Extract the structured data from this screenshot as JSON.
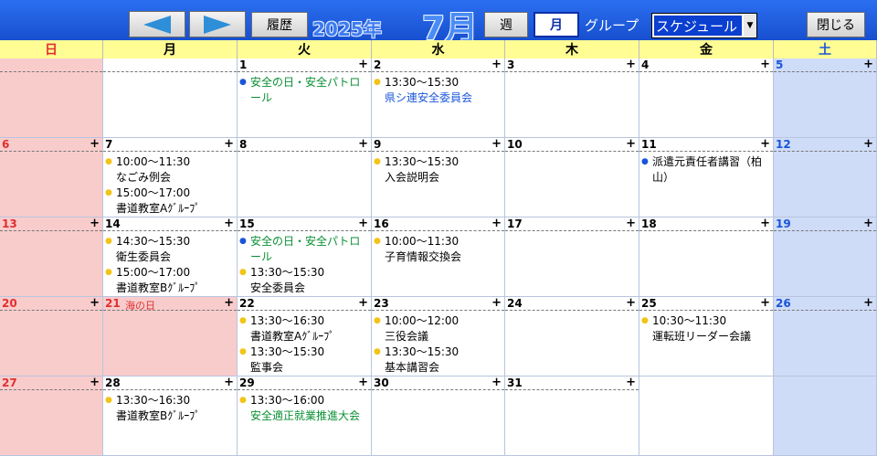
{
  "toolbar": {
    "prev_icon": "left-arrow-icon",
    "next_icon": "right-arrow-icon",
    "history": "履歴",
    "year": "2025年",
    "month": "7月",
    "week": "週",
    "month_btn": "月",
    "group": "グループ",
    "view_select": "スケジュール",
    "close": "閉じる"
  },
  "colors": {
    "sunday_bg": "#f9cccc",
    "saturday_bg": "#cfdcf7",
    "holiday_bg": "#f9cccc",
    "header_bg": "#fffd94",
    "sunday_text": "#e03030",
    "saturday_text": "#1a55d8",
    "green_dot": "#0a8f33",
    "blue_dot": "#1a55d8",
    "yellow_dot": "#f2c417"
  },
  "weekdays": [
    "日",
    "月",
    "火",
    "水",
    "木",
    "金",
    "土"
  ],
  "weeks": [
    [
      {
        "num": "",
        "type": "sun",
        "events": []
      },
      {
        "num": "",
        "type": "normal",
        "events": []
      },
      {
        "num": "1",
        "type": "normal",
        "events": [
          {
            "time": "",
            "title": "安全の日・安全パトロール",
            "dot": "blue",
            "color": "green"
          }
        ]
      },
      {
        "num": "2",
        "type": "normal",
        "events": [
          {
            "time": "13:30～15:30",
            "title": "県シ連安全委員会",
            "dot": "yellow",
            "color": "blue"
          }
        ]
      },
      {
        "num": "3",
        "type": "normal",
        "events": []
      },
      {
        "num": "4",
        "type": "normal",
        "events": []
      },
      {
        "num": "5",
        "type": "sat",
        "events": []
      }
    ],
    [
      {
        "num": "6",
        "type": "sun",
        "events": []
      },
      {
        "num": "7",
        "type": "normal",
        "events": [
          {
            "time": "10:00～11:30",
            "title": "なごみ例会",
            "dot": "yellow",
            "color": "black"
          },
          {
            "time": "15:00～17:00",
            "title": "書道教室Aｸﾞﾙｰﾌﾟ",
            "dot": "yellow",
            "color": "black"
          }
        ]
      },
      {
        "num": "8",
        "type": "normal",
        "events": []
      },
      {
        "num": "9",
        "type": "normal",
        "events": [
          {
            "time": "13:30～15:30",
            "title": "入会説明会",
            "dot": "yellow",
            "color": "black"
          }
        ]
      },
      {
        "num": "10",
        "type": "normal",
        "events": []
      },
      {
        "num": "11",
        "type": "normal",
        "events": [
          {
            "time": "",
            "title": "派遣元責任者講習（柏山）",
            "dot": "blue",
            "color": "black"
          }
        ]
      },
      {
        "num": "12",
        "type": "sat",
        "events": []
      }
    ],
    [
      {
        "num": "13",
        "type": "sun",
        "events": []
      },
      {
        "num": "14",
        "type": "normal",
        "events": [
          {
            "time": "14:30～15:30",
            "title": "衛生委員会",
            "dot": "yellow",
            "color": "black"
          },
          {
            "time": "15:00～17:00",
            "title": "書道教室Bｸﾞﾙｰﾌﾟ",
            "dot": "yellow",
            "color": "black"
          }
        ]
      },
      {
        "num": "15",
        "type": "normal",
        "events": [
          {
            "time": "",
            "title": "安全の日・安全パトロール",
            "dot": "blue",
            "color": "green"
          },
          {
            "time": "13:30～15:30",
            "title": "安全委員会",
            "dot": "yellow",
            "color": "black"
          }
        ]
      },
      {
        "num": "16",
        "type": "normal",
        "events": [
          {
            "time": "10:00～11:30",
            "title": "子育情報交換会",
            "dot": "yellow",
            "color": "black"
          }
        ]
      },
      {
        "num": "17",
        "type": "normal",
        "events": []
      },
      {
        "num": "18",
        "type": "normal",
        "events": []
      },
      {
        "num": "19",
        "type": "sat",
        "events": []
      }
    ],
    [
      {
        "num": "20",
        "type": "sun",
        "events": []
      },
      {
        "num": "21",
        "type": "holiday",
        "holiday": "海の日",
        "events": []
      },
      {
        "num": "22",
        "type": "normal",
        "events": [
          {
            "time": "13:30～16:30",
            "title": "書道教室Aｸﾞﾙｰﾌﾟ",
            "dot": "yellow",
            "color": "black"
          },
          {
            "time": "13:30～15:30",
            "title": "監事会",
            "dot": "yellow",
            "color": "black"
          }
        ]
      },
      {
        "num": "23",
        "type": "normal",
        "events": [
          {
            "time": "10:00～12:00",
            "title": "三役会議",
            "dot": "yellow",
            "color": "black"
          },
          {
            "time": "13:30～15:30",
            "title": "基本講習会",
            "dot": "yellow",
            "color": "black"
          }
        ]
      },
      {
        "num": "24",
        "type": "normal",
        "events": []
      },
      {
        "num": "25",
        "type": "normal",
        "events": [
          {
            "time": "10:30～11:30",
            "title": "運転班リーダー会議",
            "dot": "yellow",
            "color": "black"
          }
        ]
      },
      {
        "num": "26",
        "type": "sat",
        "events": []
      }
    ],
    [
      {
        "num": "27",
        "type": "sun",
        "events": []
      },
      {
        "num": "28",
        "type": "normal",
        "events": [
          {
            "time": "13:30～16:30",
            "title": "書道教室Bｸﾞﾙｰﾌﾟ",
            "dot": "yellow",
            "color": "black"
          }
        ]
      },
      {
        "num": "29",
        "type": "normal",
        "events": [
          {
            "time": "13:30～16:00",
            "title": "安全適正就業推進大会",
            "dot": "yellow",
            "color": "green"
          }
        ]
      },
      {
        "num": "30",
        "type": "normal",
        "events": []
      },
      {
        "num": "31",
        "type": "normal",
        "events": []
      },
      {
        "num": "",
        "type": "normal",
        "events": []
      },
      {
        "num": "",
        "type": "sat",
        "events": []
      }
    ]
  ],
  "add_symbol": "+",
  "dot_symbol": "●"
}
